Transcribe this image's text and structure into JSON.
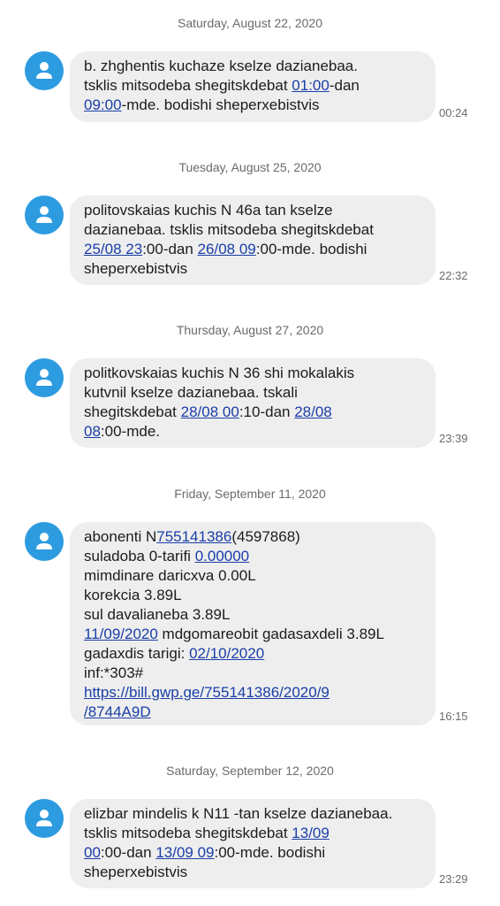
{
  "conversation": [
    {
      "date": "Saturday, August 22, 2020",
      "time": "00:24",
      "lines": [
        [
          {
            "t": "b. zhghentis kuchaze kselze dazianebaa."
          }
        ],
        [
          {
            "t": "tsklis mitsodeba shegitskdebat "
          },
          {
            "t": "01:00",
            "link": true
          },
          {
            "t": "-dan"
          }
        ],
        [
          {
            "t": "09:00",
            "link": true
          },
          {
            "t": "-mde. bodishi sheperxebistvis"
          }
        ]
      ]
    },
    {
      "date": "Tuesday, August 25, 2020",
      "time": "22:32",
      "lines": [
        [
          {
            "t": "politovskaias kuchis N 46a tan kselze"
          }
        ],
        [
          {
            "t": "dazianebaa. tsklis mitsodeba shegitskdebat"
          }
        ],
        [
          {
            "t": "25/08 23",
            "link": true
          },
          {
            "t": ":00-dan "
          },
          {
            "t": "26/08 09",
            "link": true
          },
          {
            "t": ":00-mde. bodishi"
          }
        ],
        [
          {
            "t": "sheperxebistvis"
          }
        ]
      ]
    },
    {
      "date": "Thursday, August 27, 2020",
      "time": "23:39",
      "lines": [
        [
          {
            "t": "politkovskaias kuchis N 36 shi mokalakis"
          }
        ],
        [
          {
            "t": "kutvnil kselze dazianebaa. tskali"
          }
        ],
        [
          {
            "t": "shegitskdebat "
          },
          {
            "t": "28/08 00",
            "link": true
          },
          {
            "t": ":10-dan "
          },
          {
            "t": "28/08",
            "link": true
          }
        ],
        [
          {
            "t": "08",
            "link": true
          },
          {
            "t": ":00-mde."
          }
        ]
      ]
    },
    {
      "date": "Friday, September 11, 2020",
      "time": "16:15",
      "lines": [
        [
          {
            "t": "abonenti N"
          },
          {
            "t": "755141386",
            "link": true
          },
          {
            "t": "(4597868)"
          }
        ],
        [
          {
            "t": "suladoba 0-tarifi "
          },
          {
            "t": "0.00000",
            "link": true
          }
        ],
        [
          {
            "t": "mimdinare daricxva 0.00L"
          }
        ],
        [
          {
            "t": "korekcia 3.89L"
          }
        ],
        [
          {
            "t": "sul davalianeba 3.89L"
          }
        ],
        [
          {
            "t": "11/09/2020",
            "link": true
          },
          {
            "t": " mdgomareobit gadasaxdeli 3.89L"
          }
        ],
        [
          {
            "t": "gadaxdis tarigi: "
          },
          {
            "t": "02/10/2020",
            "link": true
          }
        ],
        [
          {
            "t": "inf:*303#"
          }
        ],
        [
          {
            "t": "https://bill.gwp.ge/755141386/2020/9",
            "link": true
          }
        ],
        [
          {
            "t": "/8744A9D",
            "link": true
          }
        ]
      ]
    },
    {
      "date": "Saturday, September 12, 2020",
      "time": "23:29",
      "lines": [
        [
          {
            "t": "elizbar mindelis k N11 -tan kselze dazianebaa."
          }
        ],
        [
          {
            "t": "tsklis mitsodeba shegitskdebat "
          },
          {
            "t": "13/09",
            "link": true
          }
        ],
        [
          {
            "t": "00",
            "link": true
          },
          {
            "t": ":00-dan "
          },
          {
            "t": "13/09 09",
            "link": true
          },
          {
            "t": ":00-mde. bodishi"
          }
        ],
        [
          {
            "t": "sheperxebistvis"
          }
        ]
      ]
    }
  ],
  "colors": {
    "avatar_bg": "#2d9be0",
    "bubble_bg": "#eeeeee",
    "link": "#1a3ea8",
    "meta_text": "#6b6b6b"
  },
  "icons": {
    "avatar": "person-icon"
  }
}
